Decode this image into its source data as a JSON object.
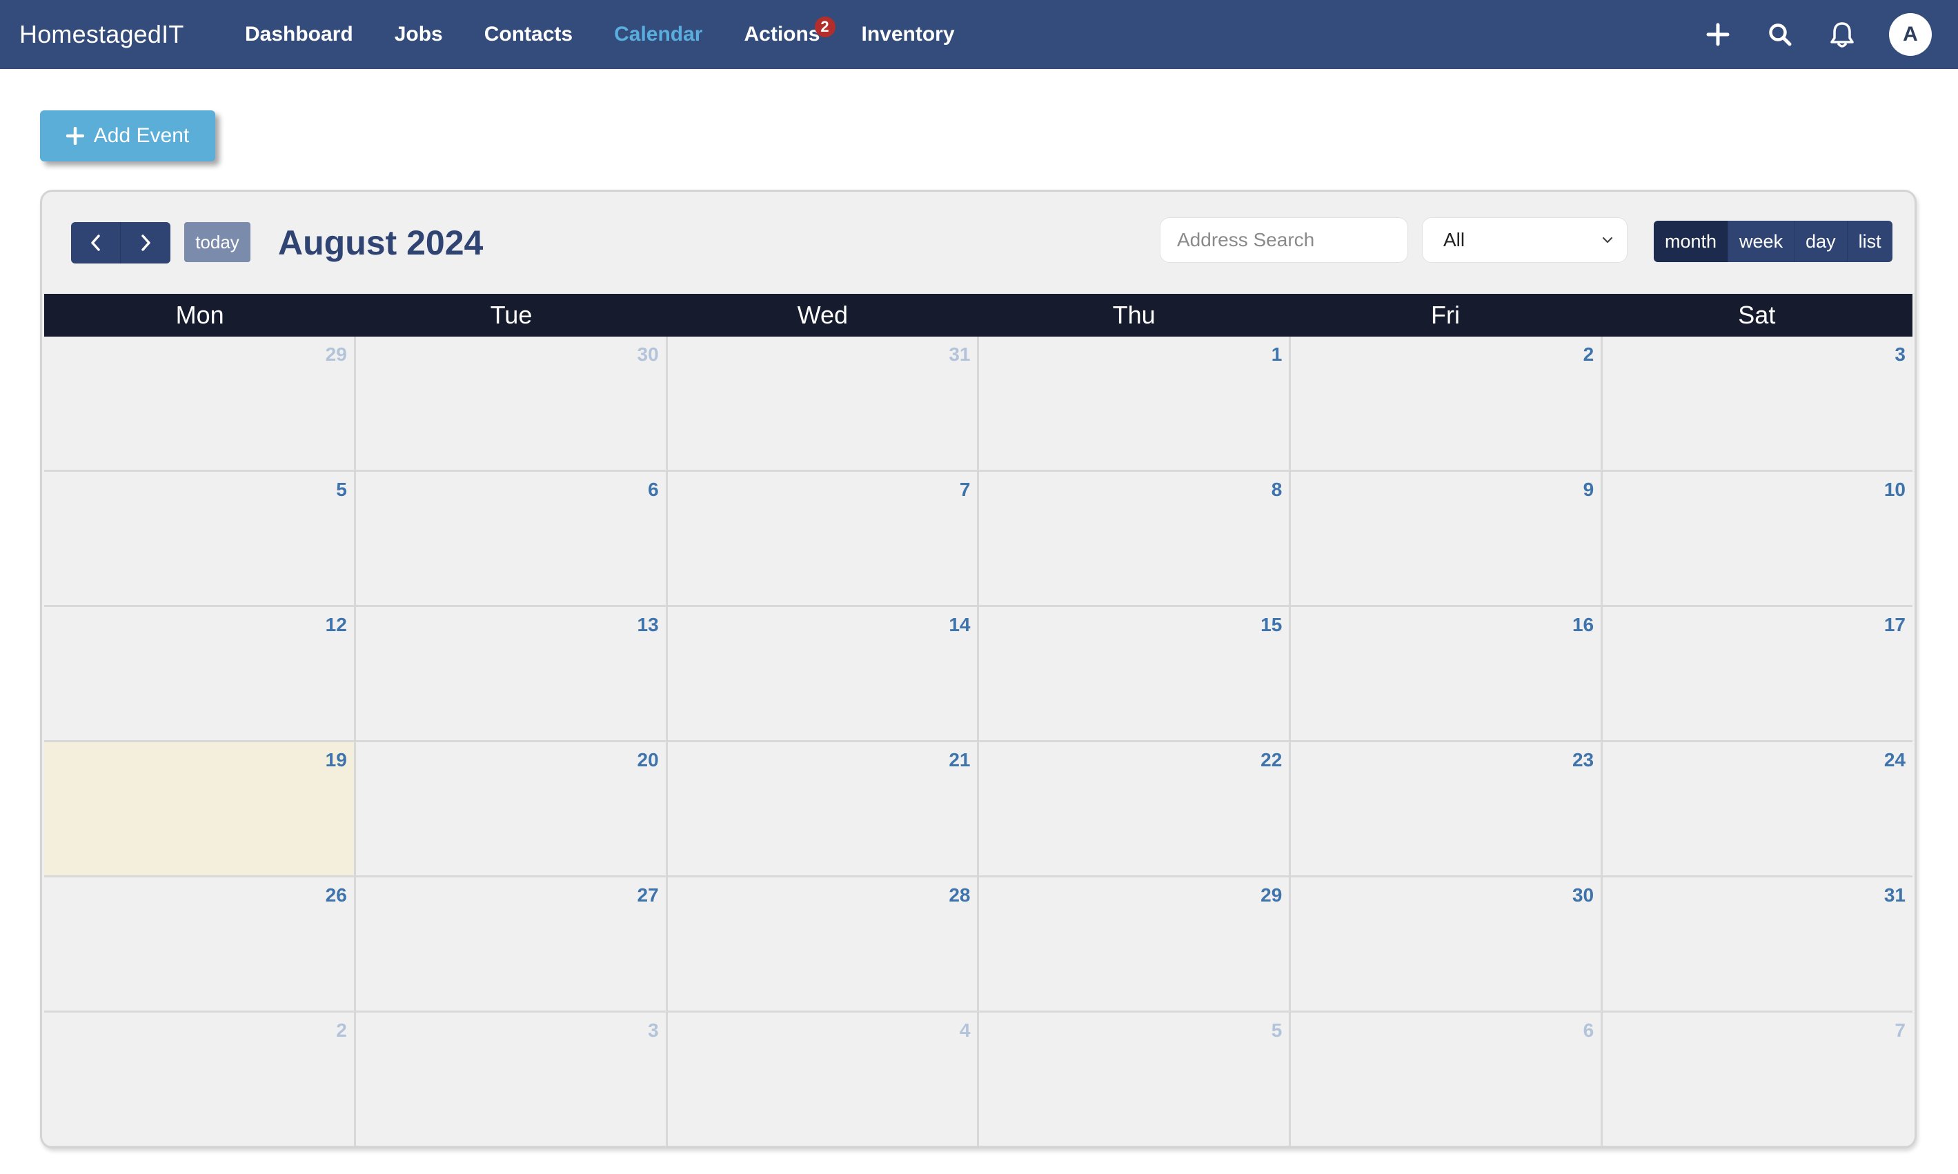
{
  "app": {
    "brand": "HomestagedIT"
  },
  "nav": {
    "links": [
      {
        "label": "Dashboard",
        "active": false
      },
      {
        "label": "Jobs",
        "active": false
      },
      {
        "label": "Contacts",
        "active": false
      },
      {
        "label": "Calendar",
        "active": true
      },
      {
        "label": "Actions",
        "active": false,
        "badge": "2"
      },
      {
        "label": "Inventory",
        "active": false
      }
    ],
    "icons": [
      "plus-icon",
      "search-icon",
      "bell-icon"
    ],
    "avatar_initial": "A"
  },
  "actions": {
    "add_event_label": "Add Event"
  },
  "calendar": {
    "today_label": "today",
    "title": "August 2024",
    "search_placeholder": "Address Search",
    "filter_value": "All",
    "views": [
      {
        "label": "month",
        "active": true
      },
      {
        "label": "week",
        "active": false
      },
      {
        "label": "day",
        "active": false
      },
      {
        "label": "list",
        "active": false
      }
    ],
    "days_of_week": [
      "Mon",
      "Tue",
      "Wed",
      "Thu",
      "Fri",
      "Sat"
    ],
    "weeks": [
      [
        {
          "n": "29",
          "other": true
        },
        {
          "n": "30",
          "other": true
        },
        {
          "n": "31",
          "other": true
        },
        {
          "n": "1"
        },
        {
          "n": "2"
        },
        {
          "n": "3"
        }
      ],
      [
        {
          "n": "5"
        },
        {
          "n": "6"
        },
        {
          "n": "7"
        },
        {
          "n": "8"
        },
        {
          "n": "9"
        },
        {
          "n": "10"
        }
      ],
      [
        {
          "n": "12"
        },
        {
          "n": "13"
        },
        {
          "n": "14"
        },
        {
          "n": "15"
        },
        {
          "n": "16"
        },
        {
          "n": "17"
        }
      ],
      [
        {
          "n": "19",
          "today": true
        },
        {
          "n": "20"
        },
        {
          "n": "21"
        },
        {
          "n": "22"
        },
        {
          "n": "23"
        },
        {
          "n": "24"
        }
      ],
      [
        {
          "n": "26"
        },
        {
          "n": "27"
        },
        {
          "n": "28"
        },
        {
          "n": "29"
        },
        {
          "n": "30"
        },
        {
          "n": "31"
        }
      ],
      [
        {
          "n": "2",
          "other": true
        },
        {
          "n": "3",
          "other": true
        },
        {
          "n": "4",
          "other": true
        },
        {
          "n": "5",
          "other": true
        },
        {
          "n": "6",
          "other": true
        },
        {
          "n": "7",
          "other": true
        }
      ]
    ]
  },
  "colors": {
    "navbar": "#344c7b",
    "active_link": "#5aaede",
    "badge": "#b22d2b",
    "primary_button": "#5aaed8",
    "calendar_button": "#2f4472",
    "header_row": "#161b2e",
    "today_cell": "#f4efdc",
    "day_number": "#3e73ac",
    "other_month_number": "#b3c4da"
  }
}
